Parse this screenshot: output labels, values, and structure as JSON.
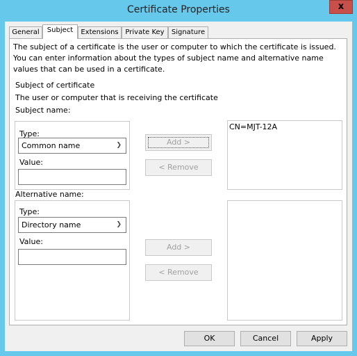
{
  "window": {
    "title": "Certificate Properties",
    "close_label": "x"
  },
  "tabs": [
    {
      "label": "General",
      "active": false
    },
    {
      "label": "Subject",
      "active": true
    },
    {
      "label": "Extensions",
      "active": false
    },
    {
      "label": "Private Key",
      "active": false
    },
    {
      "label": "Signature",
      "active": false
    }
  ],
  "content": {
    "description": "The subject of a certificate is the user or computer to which the certificate is issued. You can enter information about the types of subject name and alternative name values that can be used in a certificate.",
    "section_title": "Subject of certificate",
    "section_subtitle": "The user or computer that is receiving the certificate",
    "subject_name": {
      "label": "Subject name:",
      "type_label": "Type:",
      "type_value": "Common name",
      "value_label": "Value:",
      "value": "",
      "add_label": "Add >",
      "remove_label": "< Remove",
      "list_items": [
        "CN=MJT-12A"
      ]
    },
    "alternative_name": {
      "label": "Alternative name:",
      "type_label": "Type:",
      "type_value": "Directory name",
      "value_label": "Value:",
      "value": "",
      "add_label": "Add >",
      "remove_label": "< Remove",
      "list_items": []
    }
  },
  "footer": {
    "ok_label": "OK",
    "cancel_label": "Cancel",
    "apply_label": "Apply"
  }
}
